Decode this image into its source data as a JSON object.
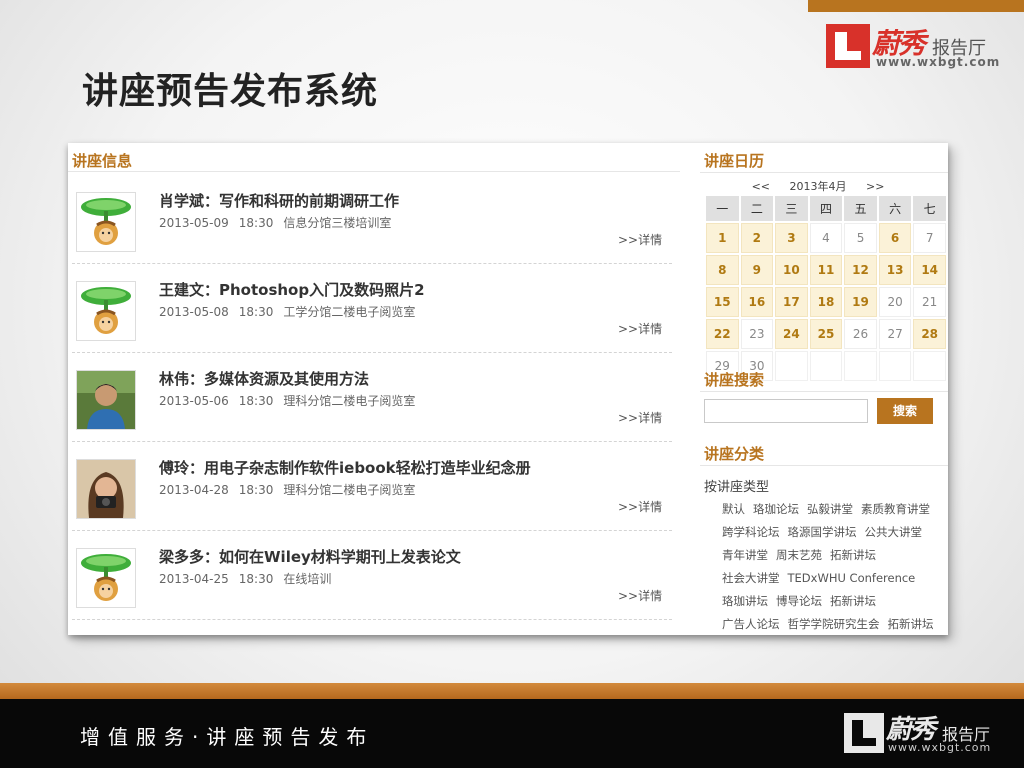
{
  "header": {
    "title": "讲座预告发布系统",
    "logo": {
      "brand": "蔚秀",
      "hall": "报告厅",
      "url": "www.wxbgt.com"
    }
  },
  "lectures": {
    "heading": "讲座信息",
    "more_label": ">>详情",
    "items": [
      {
        "title": "肖学斌：写作和科研的前期调研工作",
        "date": "2013-05-09",
        "time": "18:30",
        "place": "信息分馆三楼培训室",
        "avatar": "cartoon-lotus"
      },
      {
        "title": "王建文：Photoshop入门及数码照片2",
        "date": "2013-05-08",
        "time": "18:30",
        "place": "工学分馆二楼电子阅览室",
        "avatar": "cartoon-lotus"
      },
      {
        "title": "林伟：多媒体资源及其使用方法",
        "date": "2013-05-06",
        "time": "18:30",
        "place": "理科分馆二楼电子阅览室",
        "avatar": "photo-man"
      },
      {
        "title": "傅玲：用电子杂志制作软件iebook轻松打造毕业纪念册",
        "date": "2013-04-28",
        "time": "18:30",
        "place": "理科分馆二楼电子阅览室",
        "avatar": "photo-woman"
      },
      {
        "title": "梁多多：如何在Wiley材料学期刊上发表论文",
        "date": "2013-04-25",
        "time": "18:30",
        "place": "在线培训",
        "avatar": "cartoon-lotus"
      }
    ]
  },
  "calendar": {
    "heading": "讲座日历",
    "prev": "<<",
    "month": "2013年4月",
    "next": ">>",
    "weekdays": [
      "一",
      "二",
      "三",
      "四",
      "五",
      "六",
      "七"
    ],
    "weeks": [
      [
        "1",
        "2",
        "3",
        "4",
        "5",
        "6",
        "7"
      ],
      [
        "8",
        "9",
        "10",
        "11",
        "12",
        "13",
        "14"
      ],
      [
        "15",
        "16",
        "17",
        "18",
        "19",
        "20",
        "21"
      ],
      [
        "22",
        "23",
        "24",
        "25",
        "26",
        "27",
        "28"
      ],
      [
        "29",
        "30",
        "",
        "",
        "",
        "",
        ""
      ]
    ],
    "event_days": [
      "1",
      "2",
      "3",
      "6",
      "8",
      "9",
      "10",
      "11",
      "12",
      "13",
      "14",
      "15",
      "16",
      "17",
      "18",
      "19",
      "22",
      "24",
      "25",
      "28"
    ]
  },
  "search": {
    "heading": "讲座搜索",
    "placeholder": "",
    "button": "搜索"
  },
  "categories": {
    "heading": "讲座分类",
    "type_label": "按讲座类型",
    "rows": [
      [
        "默认",
        "珞珈论坛",
        "弘毅讲堂",
        "素质教育讲堂"
      ],
      [
        "跨学科论坛",
        "珞源国学讲坛",
        "公共大讲堂"
      ],
      [
        "青年讲堂",
        "周末艺苑",
        "拓新讲坛"
      ],
      [
        "社会大讲堂",
        "TEDxWHU Conference"
      ],
      [
        "珞珈讲坛",
        "博导论坛",
        "拓新讲坛"
      ],
      [
        "广告人论坛",
        "哲学学院研究生会",
        "拓新讲坛"
      ]
    ]
  },
  "footer": {
    "slogan": "增值服务·讲座预告发布",
    "logo": {
      "brand": "蔚秀",
      "hall": "报告厅",
      "url": "www.wxbgt.com"
    }
  },
  "colors": {
    "accent": "#b8741f",
    "calendar_event_bg": "#fbf2d8",
    "footer_bg": "#080808",
    "logo_red": "#d8312a"
  }
}
